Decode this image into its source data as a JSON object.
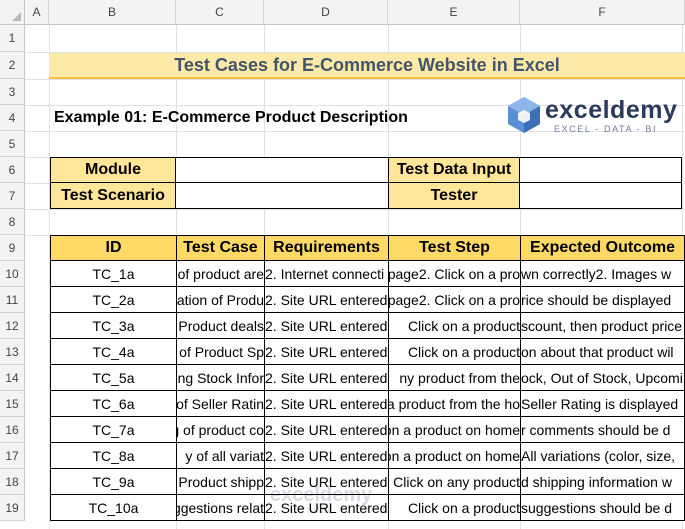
{
  "columns": [
    "A",
    "B",
    "C",
    "D",
    "E",
    "F"
  ],
  "rows": [
    "1",
    "2",
    "3",
    "4",
    "5",
    "6",
    "7",
    "8",
    "9",
    "10",
    "11",
    "12",
    "13",
    "14",
    "15",
    "16",
    "17",
    "18",
    "19"
  ],
  "title": "Test Cases for E-Commerce Website in Excel",
  "example_heading": "Example 01: E-Commerce Product Description",
  "logo": {
    "name": "exceldemy",
    "tagline": "EXCEL - DATA - BI"
  },
  "info_block": {
    "module_label": "Module",
    "module_value": "",
    "scenario_label": "Test Scenario",
    "scenario_value": "",
    "test_data_label": "Test Data Input",
    "test_data_value": "",
    "tester_label": "Tester",
    "tester_value": ""
  },
  "table": {
    "headers": [
      "ID",
      "Test Case",
      "Requirements",
      "Test Step",
      "Expected Outcome"
    ],
    "rows": [
      [
        "TC_1a",
        "of product are",
        "2. Internet connecti",
        "page2. Click on a pro",
        "wn correctly2. Images w"
      ],
      [
        "TC_2a",
        "ation of Produ",
        "2. Site URL entered",
        "page2. Click on a pro",
        "rice should be displayed"
      ],
      [
        "TC_3a",
        "Product deals",
        "2. Site URL entered",
        "Click on a product",
        "scount, then product price"
      ],
      [
        "TC_4a",
        "n of Product Sp",
        "2. Site URL entered",
        "Click on a product",
        "on about that product wil"
      ],
      [
        "TC_5a",
        "ng Stock Infor",
        "2. Site URL entered",
        "ny product from the",
        "ock, Out of Stock, Upcomi"
      ],
      [
        "TC_6a",
        "of Seller Ratin",
        "2. Site URL entered",
        "a product from the ho",
        "Seller Rating is displayed"
      ],
      [
        "TC_7a",
        "g of product co",
        "2. Site URL entered",
        "on a product on home",
        "r comments should be d"
      ],
      [
        "TC_8a",
        "y of all variat",
        "2. Site URL entered",
        "on a product on home",
        "All variations (color, size,"
      ],
      [
        "TC_9a",
        "Product shipp",
        "2. Site URL entered",
        "Click on any product",
        "d shipping information w"
      ],
      [
        "TC_10a",
        "ggestions relat",
        "2. Site URL entered",
        "Click on a product",
        "suggestions should be d"
      ]
    ]
  },
  "watermark": {
    "name": "exceldemy",
    "tagline": "EXCEL - DATA - BI"
  }
}
